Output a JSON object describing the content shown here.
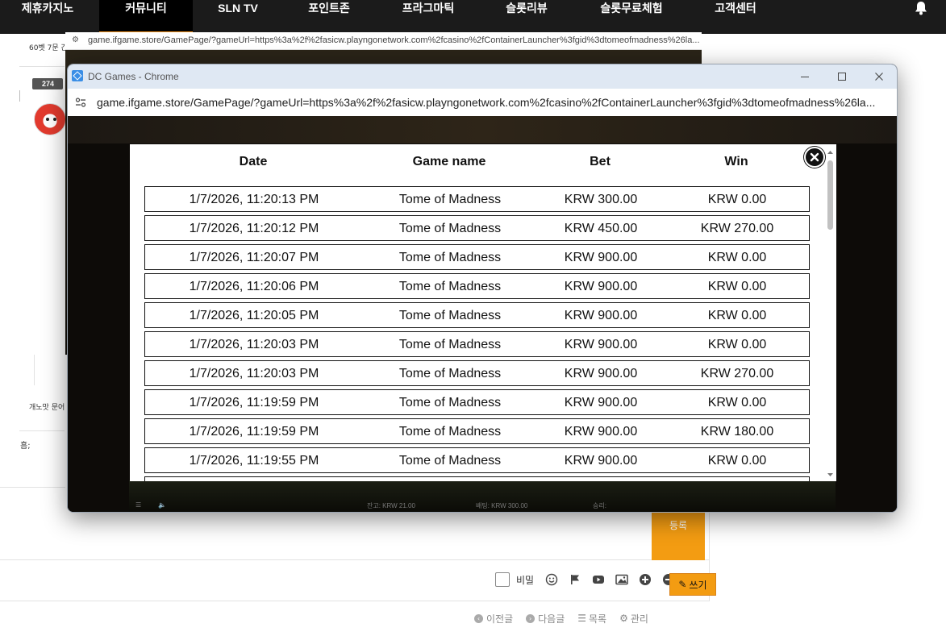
{
  "nav": {
    "items": [
      {
        "label": "제휴카지노",
        "active": false
      },
      {
        "label": "커뮤니티",
        "active": true
      },
      {
        "label": "SLN TV",
        "active": false
      },
      {
        "label": "포인트존",
        "active": false
      },
      {
        "label": "프라그마틱",
        "active": false
      },
      {
        "label": "슬롯리뷰",
        "active": false
      },
      {
        "label": "슬롯무료체험",
        "active": false
      },
      {
        "label": "고객센터",
        "active": false
      }
    ],
    "accent": "#f7941d"
  },
  "background_page": {
    "snippet1": "60벳 7문 간",
    "level_badge": "274",
    "snippet2": "개노맛 문어",
    "snippet3": "흠;",
    "register_label": "등록",
    "secret_label": "비밀",
    "footer": {
      "prev": "이전글",
      "next": "다음글",
      "list": "목록",
      "manage": "관리",
      "write": "쓰기"
    }
  },
  "back_window": {
    "url": "game.ifgame.store/GamePage/?gameUrl=https%3a%2f%2fasicw.playngonetwork.com%2fcasino%2fContainerLauncher%3fgid%3dtomeofmadness%26la..."
  },
  "window": {
    "title": "DC Games - Chrome",
    "url": "game.ifgame.store/GamePage/?gameUrl=https%3a%2f%2fasicw.playngonetwork.com%2fcasino%2fContainerLauncher%3fgid%3dtomeofmadness%26la..."
  },
  "game_strip": {
    "balance": "잔고: KRW 21.00",
    "bet": "배팅: KRW 300.00",
    "win": "승리:"
  },
  "history": {
    "headers": {
      "date": "Date",
      "game": "Game name",
      "bet": "Bet",
      "win": "Win"
    },
    "rows": [
      {
        "date": "1/7/2026, 11:20:13 PM",
        "game": "Tome of Madness",
        "bet": "KRW 300.00",
        "win": "KRW 0.00"
      },
      {
        "date": "1/7/2026, 11:20:12 PM",
        "game": "Tome of Madness",
        "bet": "KRW 450.00",
        "win": "KRW 270.00"
      },
      {
        "date": "1/7/2026, 11:20:07 PM",
        "game": "Tome of Madness",
        "bet": "KRW 900.00",
        "win": "KRW 0.00"
      },
      {
        "date": "1/7/2026, 11:20:06 PM",
        "game": "Tome of Madness",
        "bet": "KRW 900.00",
        "win": "KRW 0.00"
      },
      {
        "date": "1/7/2026, 11:20:05 PM",
        "game": "Tome of Madness",
        "bet": "KRW 900.00",
        "win": "KRW 0.00"
      },
      {
        "date": "1/7/2026, 11:20:03 PM",
        "game": "Tome of Madness",
        "bet": "KRW 900.00",
        "win": "KRW 0.00"
      },
      {
        "date": "1/7/2026, 11:20:03 PM",
        "game": "Tome of Madness",
        "bet": "KRW 900.00",
        "win": "KRW 270.00"
      },
      {
        "date": "1/7/2026, 11:19:59 PM",
        "game": "Tome of Madness",
        "bet": "KRW 900.00",
        "win": "KRW 0.00"
      },
      {
        "date": "1/7/2026, 11:19:59 PM",
        "game": "Tome of Madness",
        "bet": "KRW 900.00",
        "win": "KRW 180.00"
      },
      {
        "date": "1/7/2026, 11:19:55 PM",
        "game": "Tome of Madness",
        "bet": "KRW 900.00",
        "win": "KRW 0.00"
      }
    ]
  }
}
